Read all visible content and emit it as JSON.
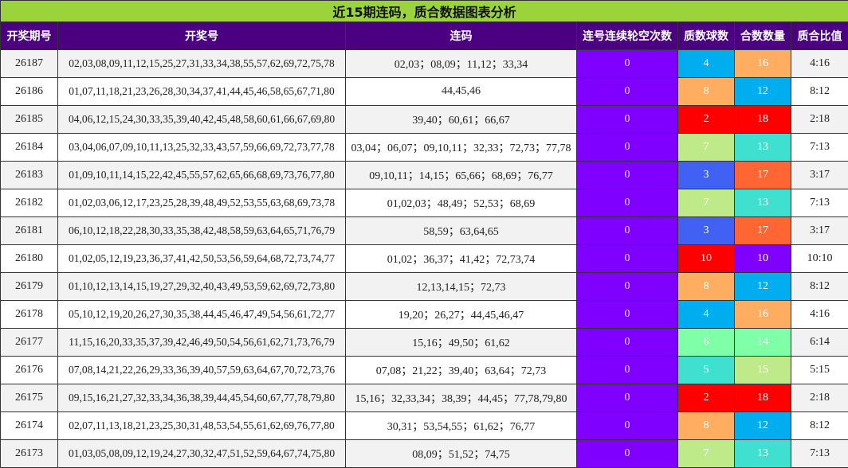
{
  "title": "近15期连码，质合数据图表分析",
  "headers": [
    "开奖期号",
    "开奖号",
    "连码",
    "连号连续轮空次数",
    "质数球数",
    "合数数量",
    "质合比值"
  ],
  "rows": [
    {
      "period": "26187",
      "numbers": "02,03,08,09,11,12,15,25,27,31,33,34,38,55,57,62,69,72,75,78",
      "lian": "02,03；08,09；11,12；33,34",
      "count": "0",
      "prime": "4",
      "comp": "16",
      "ratio": "4:16"
    },
    {
      "period": "26186",
      "numbers": "01,07,11,18,21,23,26,28,30,34,37,41,44,45,46,58,65,67,71,80",
      "lian": "44,45,46",
      "count": "0",
      "prime": "8",
      "comp": "12",
      "ratio": "8:12"
    },
    {
      "period": "26185",
      "numbers": "04,06,12,15,24,30,33,35,39,40,42,45,48,58,60,61,66,67,69,80",
      "lian": "39,40；60,61；66,67",
      "count": "0",
      "prime": "2",
      "comp": "18",
      "ratio": "2:18"
    },
    {
      "period": "26184",
      "numbers": "03,04,06,07,09,10,11,13,25,32,33,43,57,59,66,69,72,73,77,78",
      "lian": "03,04；06,07；09,10,11；32,33；72,73；77,78",
      "count": "0",
      "prime": "7",
      "comp": "13",
      "ratio": "7:13"
    },
    {
      "period": "26183",
      "numbers": "01,09,10,11,14,15,22,42,45,55,57,62,65,66,68,69,73,76,77,80",
      "lian": "09,10,11；14,15；65,66；68,69；76,77",
      "count": "0",
      "prime": "3",
      "comp": "17",
      "ratio": "3:17"
    },
    {
      "period": "26182",
      "numbers": "01,02,03,06,12,17,23,25,28,39,48,49,52,53,55,63,68,69,73,78",
      "lian": "01,02,03；48,49；52,53；68,69",
      "count": "0",
      "prime": "7",
      "comp": "13",
      "ratio": "7:13"
    },
    {
      "period": "26181",
      "numbers": "06,10,12,18,22,28,30,33,35,38,42,48,58,59,63,64,65,71,76,79",
      "lian": "58,59；63,64,65",
      "count": "0",
      "prime": "3",
      "comp": "17",
      "ratio": "3:17"
    },
    {
      "period": "26180",
      "numbers": "01,02,05,12,19,23,36,37,41,42,50,53,56,59,64,68,72,73,74,77",
      "lian": "01,02；36,37；41,42；72,73,74",
      "count": "0",
      "prime": "10",
      "comp": "10",
      "ratio": "10:10"
    },
    {
      "period": "26179",
      "numbers": "01,10,12,13,14,15,19,27,29,32,40,43,49,53,59,62,69,72,73,80",
      "lian": "12,13,14,15；72,73",
      "count": "0",
      "prime": "8",
      "comp": "12",
      "ratio": "8:12"
    },
    {
      "period": "26178",
      "numbers": "05,10,12,19,20,26,27,30,35,38,44,45,46,47,49,54,56,61,72,77",
      "lian": "19,20；26,27；44,45,46,47",
      "count": "0",
      "prime": "4",
      "comp": "16",
      "ratio": "4:16"
    },
    {
      "period": "26177",
      "numbers": "11,15,16,20,33,35,37,39,42,46,49,50,54,56,61,62,71,73,76,79",
      "lian": "15,16；49,50；61,62",
      "count": "0",
      "prime": "6",
      "comp": "14",
      "ratio": "6:14"
    },
    {
      "period": "26176",
      "numbers": "07,08,14,21,22,26,29,33,36,39,40,57,59,63,64,67,70,72,73,76",
      "lian": "07,08；21,22；39,40；63,64；72,73",
      "count": "0",
      "prime": "5",
      "comp": "15",
      "ratio": "5:15"
    },
    {
      "period": "26175",
      "numbers": "09,15,16,21,27,32,33,34,36,38,39,44,45,54,60,67,77,78,79,80",
      "lian": "15,16；32,33,34；38,39；44,45；77,78,79,80",
      "count": "0",
      "prime": "2",
      "comp": "18",
      "ratio": "2:18"
    },
    {
      "period": "26174",
      "numbers": "02,07,11,13,18,21,23,25,30,31,48,53,54,55,61,62,69,76,77,80",
      "lian": "30,31；53,54,55；61,62；76,77",
      "count": "0",
      "prime": "8",
      "comp": "12",
      "ratio": "8:12"
    },
    {
      "period": "26173",
      "numbers": "01,03,05,08,09,12,19,24,27,30,32,47,51,52,59,64,67,74,75,80",
      "lian": "08,09；51,52；74,75",
      "count": "0",
      "prime": "7",
      "comp": "13",
      "ratio": "7:13"
    }
  ],
  "value_colors": {
    "2": "#ff0000",
    "3": "#4161f5",
    "4": "#00aeef",
    "5": "#40e0d0",
    "6": "#7fffa8",
    "7": "#bfea8a",
    "8": "#ffad60",
    "10": "#ff0000",
    "12": "#00aeef",
    "13": "#40e0d0",
    "14": "#7fffa8",
    "15": "#bfea8a",
    "16": "#ffad60",
    "17": "#ff6633",
    "18": "#ff0000"
  },
  "prime_10_color": "#ff0000",
  "comp_10_color": "#7f00ff",
  "count_color": "#7f00ff"
}
